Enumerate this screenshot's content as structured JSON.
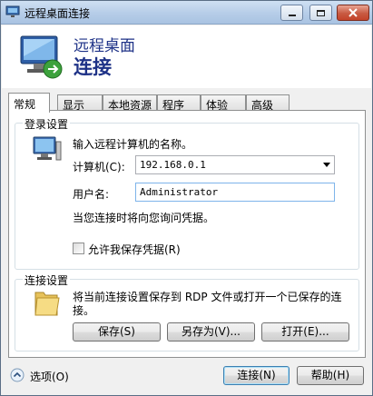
{
  "window": {
    "title": "远程桌面连接"
  },
  "header": {
    "line1": "远程桌面",
    "line2": "连接"
  },
  "tabs": [
    {
      "label": "常规",
      "active": true
    },
    {
      "label": "显示",
      "active": false
    },
    {
      "label": "本地资源",
      "active": false
    },
    {
      "label": "程序",
      "active": false
    },
    {
      "label": "体验",
      "active": false
    },
    {
      "label": "高级",
      "active": false
    }
  ],
  "login": {
    "group_label": "登录设置",
    "prompt": "输入远程计算机的名称。",
    "computer_label": "计算机(C):",
    "computer_value": "192.168.0.1",
    "username_label": "用户名:",
    "username_value": "Administrator",
    "credentials_note": "当您连接时将向您询问凭据。",
    "save_credentials_label": "允许我保存凭据(R)",
    "save_credentials_checked": false
  },
  "connection": {
    "group_label": "连接设置",
    "description_line1": "将当前连接设置保存到 RDP 文件或打开一个已保存的连",
    "description_line2": "接。",
    "save_button": "保存(S)",
    "save_as_button": "另存为(V)...",
    "open_button": "打开(E)..."
  },
  "footer": {
    "options_label": "选项(O)",
    "connect_button": "连接(N)",
    "help_button": "帮助(H)"
  },
  "colors": {
    "header_text": "#1e3287",
    "title_bar": "#b6cde8",
    "close_button": "#c4432a"
  }
}
